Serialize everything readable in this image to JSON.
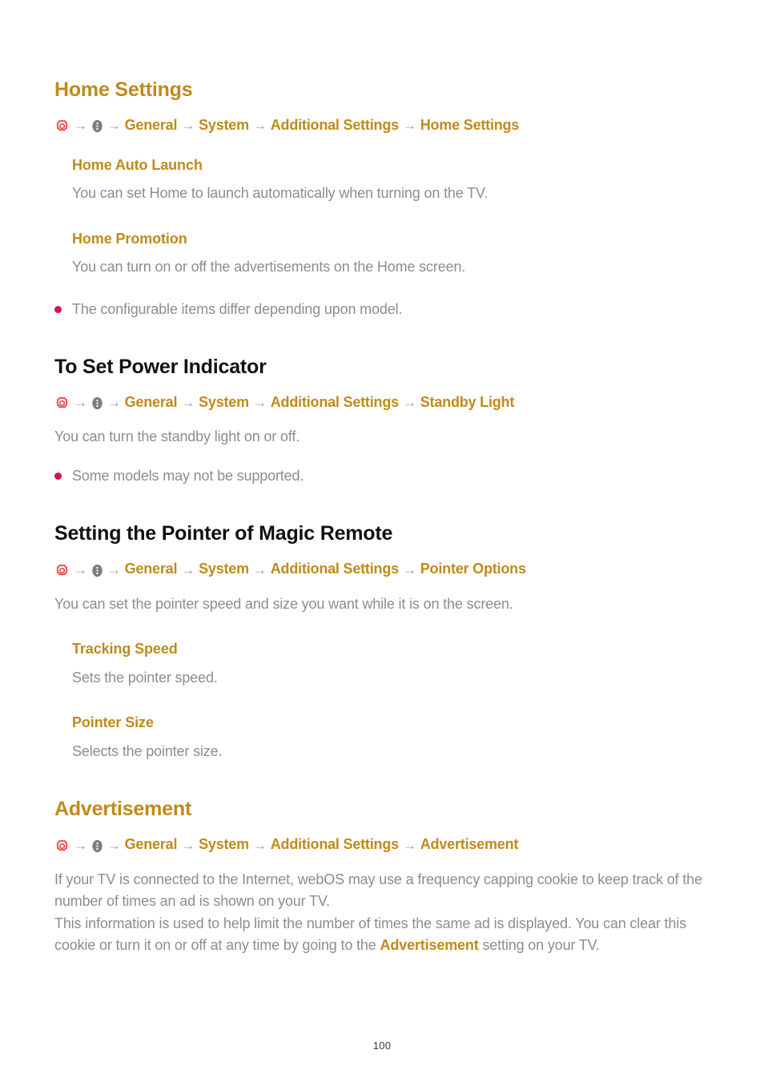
{
  "document": {
    "page_number": "100"
  },
  "icons": {
    "gear": "settings-gear-icon",
    "dots": "more-options-icon",
    "arrow": "→"
  },
  "colors": {
    "gold": "#c08a19",
    "body_gray": "#8d8d8d",
    "heading_black": "#111111",
    "bullet_crimson": "#d4134f",
    "arrow_gray": "#9b9b9b"
  },
  "sections": [
    {
      "title": "Home Settings",
      "title_color": "gold",
      "breadcrumb": [
        "General",
        "System",
        "Additional Settings",
        "Home Settings"
      ],
      "subsections": [
        {
          "heading": "Home Auto Launch",
          "body": "You can set Home to launch automatically when turning on the TV."
        },
        {
          "heading": "Home Promotion",
          "body": "You can turn on or off the advertisements on the Home screen."
        }
      ],
      "notes": [
        "The configurable items differ depending upon model."
      ]
    },
    {
      "title": "To Set Power Indicator",
      "title_color": "black",
      "breadcrumb": [
        "General",
        "System",
        "Additional Settings",
        "Standby Light"
      ],
      "body": "You can turn the standby light on or off.",
      "notes": [
        "Some models may not be supported."
      ]
    },
    {
      "title": "Setting the Pointer of Magic Remote",
      "title_color": "black",
      "breadcrumb": [
        "General",
        "System",
        "Additional Settings",
        "Pointer Options"
      ],
      "body": "You can set the pointer speed and size you want while it is on the screen.",
      "subsections": [
        {
          "heading": "Tracking Speed",
          "body": "Sets the pointer speed."
        },
        {
          "heading": "Pointer Size",
          "body": "Selects the pointer size."
        }
      ]
    },
    {
      "title": "Advertisement",
      "title_color": "gold",
      "breadcrumb": [
        "General",
        "System",
        "Additional Settings",
        "Advertisement"
      ],
      "body_parts": [
        {
          "text": "If your TV is connected to the Internet, webOS may use a frequency capping cookie to keep track of the number of times an ad is shown on your TV.",
          "bold": false
        },
        {
          "text": "This information is used to help limit the number of times the same ad is displayed. You can clear this cookie or turn it on or off at any time by going to the ",
          "bold": false
        },
        {
          "text": "Advertisement",
          "bold": true
        },
        {
          "text": " setting on your TV.",
          "bold": false
        }
      ]
    }
  ]
}
